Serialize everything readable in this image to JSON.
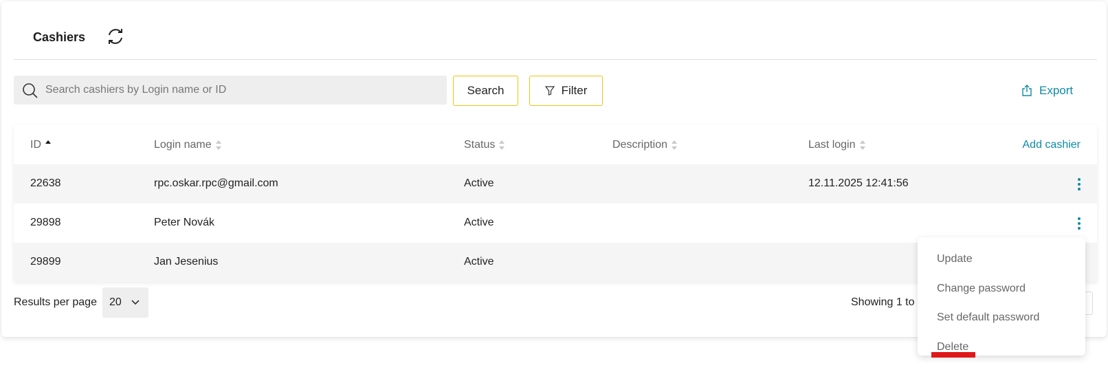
{
  "header": {
    "title": "Cashiers"
  },
  "toolbar": {
    "search_placeholder": "Search cashiers by Login name or ID",
    "search_value": "",
    "search_label": "Search",
    "filter_label": "Filter",
    "export_label": "Export"
  },
  "table": {
    "columns": [
      "ID",
      "Login name",
      "Status",
      "Description",
      "Last login"
    ],
    "sorted_column": "ID",
    "add_label": "Add cashier",
    "rows": [
      {
        "id": "22638",
        "login": "rpc.oskar.rpc@gmail.com",
        "status": "Active",
        "description": "",
        "last_login": "12.11.2025 12:41:56"
      },
      {
        "id": "29898",
        "login": "Peter Novák",
        "status": "Active",
        "description": "",
        "last_login": ""
      },
      {
        "id": "29899",
        "login": "Jan Jesenius",
        "status": "Active",
        "description": "",
        "last_login": ""
      }
    ]
  },
  "footer": {
    "per_page_label": "Results per page",
    "per_page_value": "20",
    "showing_text": "Showing 1 to"
  },
  "context_menu": {
    "items": [
      "Update",
      "Change password",
      "Set default password",
      "Delete"
    ]
  },
  "colors": {
    "accent": "#0e8aa6",
    "button_border": "#f1c40f",
    "highlight": "#e01818"
  },
  "icons": [
    "refresh-icon",
    "search-icon",
    "filter-icon",
    "export-icon",
    "sort-icon",
    "kebab-icon",
    "chevron-down-icon"
  ]
}
